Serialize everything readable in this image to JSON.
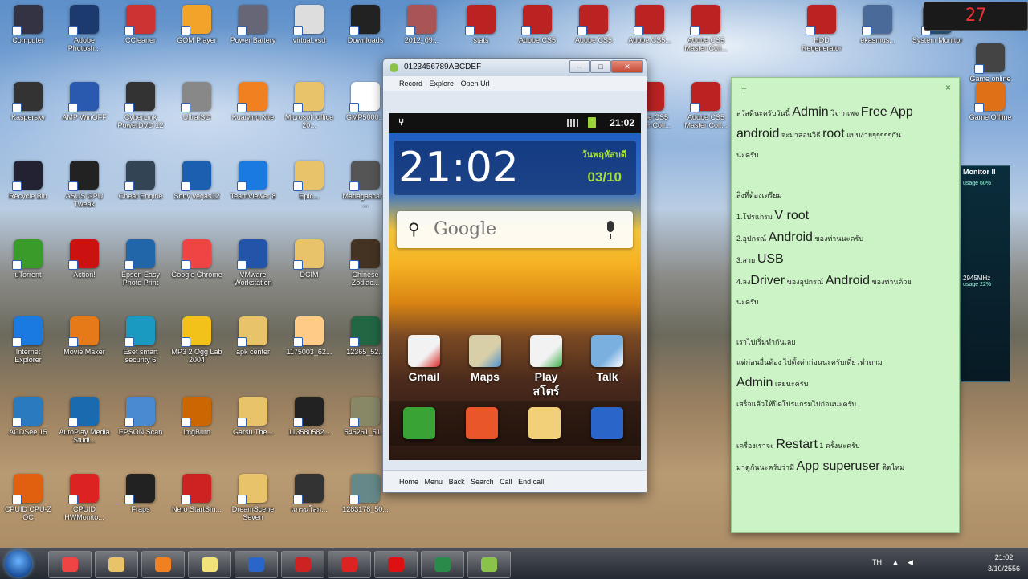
{
  "desktop": {
    "icons": [
      {
        "label": "Computer",
        "color": "#334"
      },
      {
        "label": "Adobe Photosh...",
        "color": "#1c3a6e"
      },
      {
        "label": "CCleaner",
        "color": "#c33"
      },
      {
        "label": "GOM Player",
        "color": "#f2a42a"
      },
      {
        "label": "Power Battery",
        "color": "#667"
      },
      {
        "label": "virtual.vsd",
        "color": "#ddd"
      },
      {
        "label": "Downloads",
        "color": "#222"
      },
      {
        "label": "2012_09...",
        "color": "#a55"
      },
      {
        "label": "stats",
        "color": "#b22"
      },
      {
        "label": "Adobe CS5",
        "color": "#b22"
      },
      {
        "label": "Adobe CS5",
        "color": "#b22"
      },
      {
        "label": "Adobe CS5...",
        "color": "#b22"
      },
      {
        "label": "Adobe CS5 Master Coll...",
        "color": "#b22"
      },
      {
        "label": "HDD Regenerator",
        "color": "#b22"
      },
      {
        "label": "ekasmus...",
        "color": "#4a6a9a"
      },
      {
        "label": "System Monitor",
        "color": "#2a4a6a"
      },
      {
        "label": "Game online",
        "color": "#444"
      },
      {
        "label": "Kaspersky",
        "color": "#333"
      },
      {
        "label": "AMP WinOFF",
        "color": "#2a5ab0"
      },
      {
        "label": "CyberLink PowerDVD 12",
        "color": "#333"
      },
      {
        "label": "UltraISO",
        "color": "#888"
      },
      {
        "label": "Kuaiying Kite",
        "color": "#f08020"
      },
      {
        "label": "Microsoft office 20...",
        "color": "#e8c36a"
      },
      {
        "label": "GMP5000...",
        "color": "#fff"
      },
      {
        "label": "Adobe CS5 Master Coll...",
        "color": "#b22"
      },
      {
        "label": "Adobe CS5 Master Coll...",
        "color": "#b22"
      },
      {
        "label": "Game Offline",
        "color": "#e07018"
      },
      {
        "label": "Recycle Bin",
        "color": "#223"
      },
      {
        "label": "ASUS GPU Tweak",
        "color": "#222"
      },
      {
        "label": "Cheat Engine",
        "color": "#345"
      },
      {
        "label": "Sony vegas12",
        "color": "#1a5fb0"
      },
      {
        "label": "TeamViewer 8",
        "color": "#1a7adf"
      },
      {
        "label": "Epic...",
        "color": "#e8c36a"
      },
      {
        "label": "Madagascar 3 ...",
        "color": "#555"
      },
      {
        "label": "uTorrent",
        "color": "#3a9a2a"
      },
      {
        "label": "Action!",
        "color": "#c11"
      },
      {
        "label": "Epson Easy Photo Print",
        "color": "#26a"
      },
      {
        "label": "Google Chrome",
        "color": "#e44"
      },
      {
        "label": "VMware Workstation",
        "color": "#25a"
      },
      {
        "label": "DCIM",
        "color": "#e8c36a"
      },
      {
        "label": "Chinese Zodiac...",
        "color": "#432"
      },
      {
        "label": "Internet Explorer",
        "color": "#1a7adf"
      },
      {
        "label": "Movie Maker",
        "color": "#e67a18"
      },
      {
        "label": "Eset smart security 6",
        "color": "#1a9ac0"
      },
      {
        "label": "MP3 2 Ogg Lab 2004",
        "color": "#f2c21a"
      },
      {
        "label": "apk center",
        "color": "#e8c36a"
      },
      {
        "label": "1175003_62...",
        "color": "#fc8"
      },
      {
        "label": "12365_52...",
        "color": "#264"
      },
      {
        "label": "ACDSee 15",
        "color": "#2a7ac0"
      },
      {
        "label": "AutoPlay Media Studi...",
        "color": "#1a6ab0"
      },
      {
        "label": "EPSON Scan",
        "color": "#4a8ad0"
      },
      {
        "label": "ImgBurn",
        "color": "#c60"
      },
      {
        "label": "Garsu.The...",
        "color": "#e8c36a"
      },
      {
        "label": "113580582...",
        "color": "#222"
      },
      {
        "label": "545261_51...",
        "color": "#886"
      },
      {
        "label": "CPUID CPU-Z OC",
        "color": "#e06010"
      },
      {
        "label": "CPUID HWMonito...",
        "color": "#d22"
      },
      {
        "label": "Fraps",
        "color": "#222"
      },
      {
        "label": "Nero StartSm...",
        "color": "#c22"
      },
      {
        "label": "DreamScene Seven",
        "color": "#e8c36a"
      },
      {
        "label": "แกรนโลก...",
        "color": "#333"
      },
      {
        "label": "1283178_50...",
        "color": "#688"
      }
    ]
  },
  "emulator": {
    "title": "0123456789ABCDEF",
    "menu": [
      "Record",
      "Explore",
      "Open Url"
    ],
    "status_time": "21:02",
    "clock_time": "21:02",
    "clock_day": "วันพฤหัสบดี",
    "clock_date": "03/10",
    "search_text": "Google",
    "apps": [
      {
        "label": "Gmail",
        "color": "#f2f2f2",
        "accent": "#d22"
      },
      {
        "label": "Maps",
        "color": "#d8cfa8",
        "accent": "#4a90d0"
      },
      {
        "label": "Play สโตร์",
        "color": "#f2f2f2",
        "accent": "#3ab04a"
      },
      {
        "label": "Talk",
        "color": "#7ab0e0",
        "accent": "#ffffff"
      }
    ],
    "dock": [
      {
        "name": "phone",
        "color": "#3aa335"
      },
      {
        "name": "contacts",
        "color": "#e8562a"
      },
      {
        "name": "messaging",
        "color": "#f2d07a"
      },
      {
        "name": "apps",
        "color": "#2a66c9"
      }
    ],
    "bottom_buttons": [
      "Home",
      "Menu",
      "Back",
      "Search",
      "Call",
      "End call"
    ]
  },
  "note": {
    "plus": "+",
    "close": "×",
    "lines": [
      [
        {
          "t": "สวัสดีนะครับวันนี้ ",
          "b": false
        },
        {
          "t": "Admin",
          "b": true
        },
        {
          "t": " วิจากเพจ ",
          "b": false
        },
        {
          "t": "Free App",
          "b": true
        }
      ],
      [
        {
          "t": "android",
          "b": true
        },
        {
          "t": " จะมาสอนวิธี ",
          "b": false
        },
        {
          "t": "root",
          "b": true
        },
        {
          "t": " แบบง่ายๆๆๆๆๆกัน",
          "b": false
        }
      ],
      [
        {
          "t": "นะครับ",
          "b": false
        }
      ],
      [
        {
          "t": "",
          "b": false
        }
      ],
      [
        {
          "t": "สิ่งที่ต้องเตรียม",
          "b": false
        }
      ],
      [
        {
          "t": "1.โปรแกรม ",
          "b": false
        },
        {
          "t": "V root",
          "b": true
        }
      ],
      [
        {
          "t": "2.อุปกรณ์ ",
          "b": false
        },
        {
          "t": "Android",
          "b": true
        },
        {
          "t": " ของท่านนะครับ",
          "b": false
        }
      ],
      [
        {
          "t": "3.สาย ",
          "b": false
        },
        {
          "t": "USB",
          "b": true
        }
      ],
      [
        {
          "t": "4.ลง",
          "b": false
        },
        {
          "t": "Driver",
          "b": true
        },
        {
          "t": " ของอุปกรณ์ ",
          "b": false
        },
        {
          "t": "Android",
          "b": true
        },
        {
          "t": " ของท่านด้วย",
          "b": false
        }
      ],
      [
        {
          "t": "นะครับ",
          "b": false
        }
      ],
      [
        {
          "t": "",
          "b": false
        }
      ],
      [
        {
          "t": "เราไปเริ่มทำกันเลย",
          "b": false
        }
      ],
      [
        {
          "t": "แต่ก่อนอื่นต้อง ไปตั้งค่าก่อนนะครับเดี๋ยวทำตาม",
          "b": false
        }
      ],
      [
        {
          "t": "Admin",
          "b": true
        },
        {
          "t": " เลยนะครับ",
          "b": false
        }
      ],
      [
        {
          "t": "เสร็จแล้วให้ปิดโปรแกรมไปก่อนนะครับ",
          "b": false
        }
      ],
      [
        {
          "t": "",
          "b": false
        }
      ],
      [
        {
          "t": "เครื่องเราจะ ",
          "b": false
        },
        {
          "t": "Restart",
          "b": true
        },
        {
          "t": " 1 ครั้งนะครับ",
          "b": false
        }
      ],
      [
        {
          "t": "มาดูกันนะครับว่ามี ",
          "b": false
        },
        {
          "t": "App superuser",
          "b": true
        },
        {
          "t": " ติดไหม",
          "b": false
        }
      ]
    ]
  },
  "gadget": {
    "value": "27"
  },
  "monitor": {
    "title": "Monitor II",
    "usage": "60%",
    "freq": "2945MHz",
    "usage2": "22%"
  },
  "taskbar": {
    "lang": "TH",
    "time": "21:02",
    "date": "3/10/2556",
    "buttons": [
      {
        "name": "chrome",
        "color": "#e44"
      },
      {
        "name": "explorer",
        "color": "#e8c36a"
      },
      {
        "name": "media-player",
        "color": "#f08020"
      },
      {
        "name": "sticky-notes",
        "color": "#f2e27a"
      },
      {
        "name": "network",
        "color": "#2a66c9"
      },
      {
        "name": "app-red",
        "color": "#c22"
      },
      {
        "name": "app-x",
        "color": "#d22"
      },
      {
        "name": "record",
        "color": "#d11"
      },
      {
        "name": "app-green",
        "color": "#2a8a4a"
      },
      {
        "name": "android",
        "color": "#8bc34a"
      }
    ]
  }
}
